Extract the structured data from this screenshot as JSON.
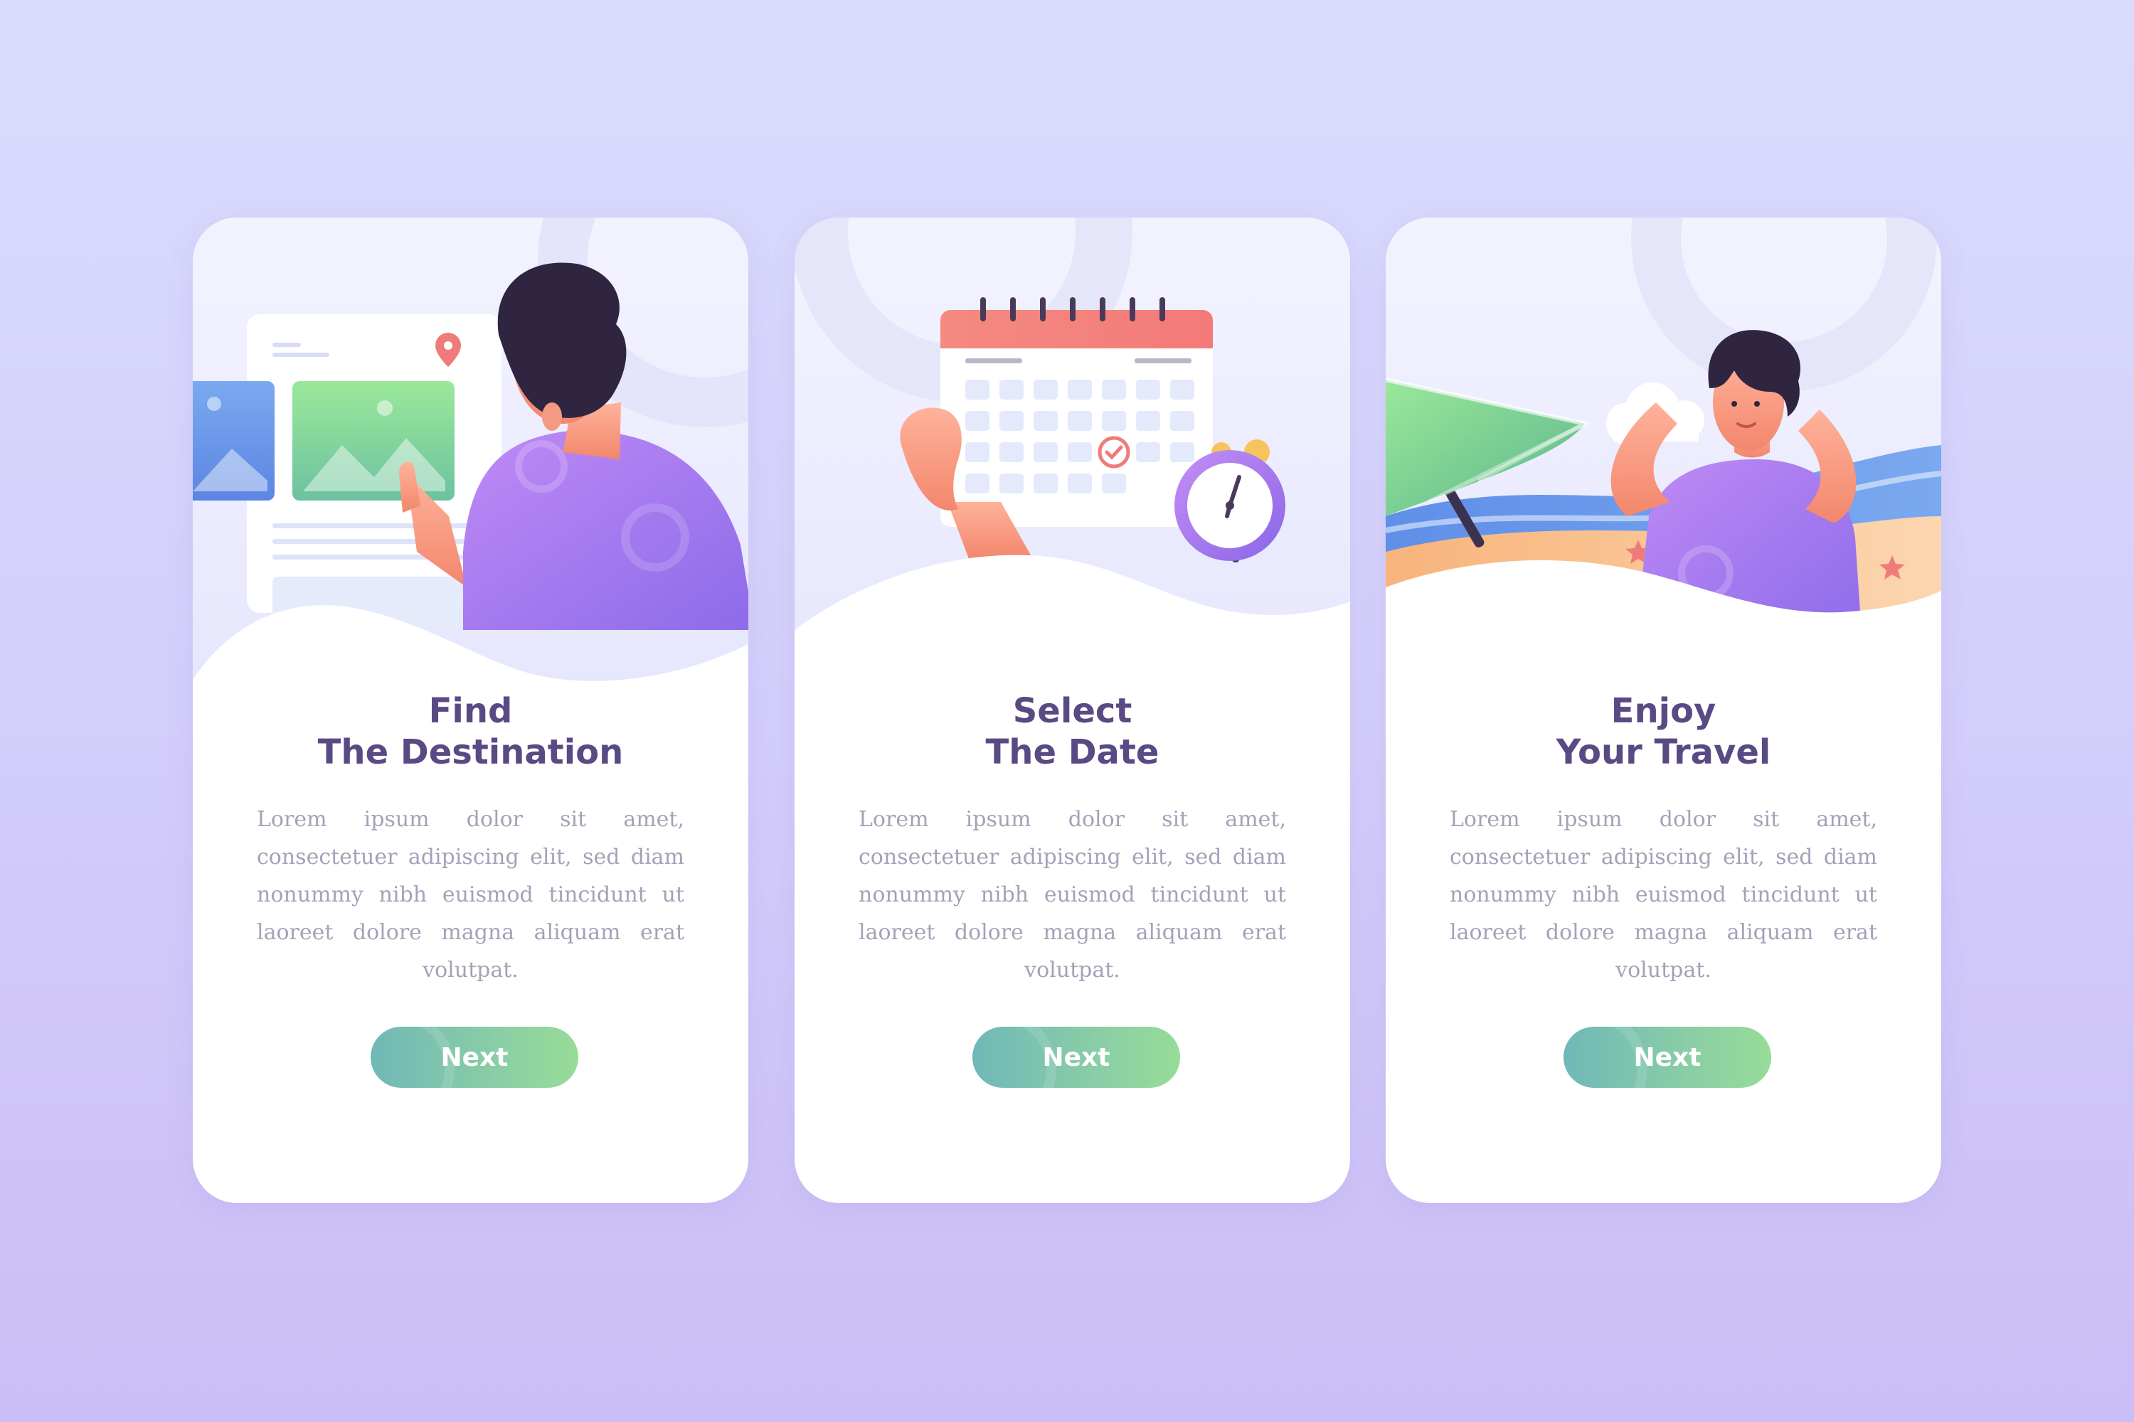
{
  "cards": [
    {
      "title_line1": "Find",
      "title_line2": "The Destination",
      "description": "Lorem ipsum dolor sit amet, consectetuer adipiscing elit, sed diam nonummy nibh euismod tincidunt ut laoreet dolore magna aliquam erat volutpat.",
      "button_label": "Next"
    },
    {
      "title_line1": "Select",
      "title_line2": "The Date",
      "description": "Lorem ipsum dolor sit amet, consectetuer adipiscing elit, sed diam nonummy nibh euismod tincidunt ut laoreet dolore magna aliquam erat volutpat.",
      "button_label": "Next"
    },
    {
      "title_line1": "Enjoy",
      "title_line2": "Your Travel",
      "description": "Lorem ipsum dolor sit amet, consectetuer adipiscing elit, sed diam nonummy nibh euismod tincidunt ut laoreet dolore magna aliquam erat volutpat.",
      "button_label": "Next"
    }
  ],
  "colors": {
    "title": "#5a4a84",
    "body_text": "#a7a0b8",
    "button_start": "#70b8b7",
    "button_end": "#97dc98",
    "shirt": "#a77cf0",
    "hair": "#2f2540"
  }
}
